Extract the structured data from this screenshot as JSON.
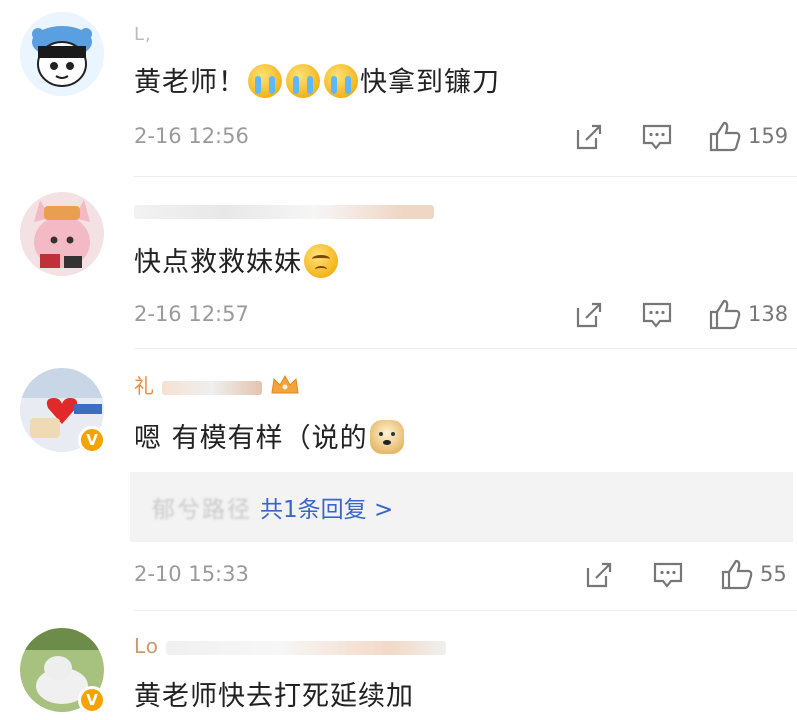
{
  "comments": [
    {
      "name": "L,",
      "text": "黄老师！",
      "text_after": "快拿到镰刀",
      "emojis": [
        "cry-icon",
        "cry-icon",
        "cry-icon"
      ],
      "time": "2-16 12:56",
      "likes": "159"
    },
    {
      "name": "",
      "text": "快点救救妹妹",
      "emojis": [
        "sad-icon"
      ],
      "time": "2-16 12:57",
      "likes": "138"
    },
    {
      "name": "礼",
      "text": "嗯 有模有样（说的",
      "emojis": [
        "doge-icon"
      ],
      "time": "2-10 15:33",
      "likes": "55",
      "reply_summary": "共1条回复 >",
      "reply_author": "郁兮路径"
    },
    {
      "name": "Lo",
      "text": "黄老师快去打死延续加",
      "emojis": [],
      "time": "",
      "likes": ""
    }
  ],
  "colors": {
    "name": "#f08a3c",
    "meta": "#9a9a9a",
    "link": "#3a66c8",
    "verified_badge": "#f5a300"
  }
}
